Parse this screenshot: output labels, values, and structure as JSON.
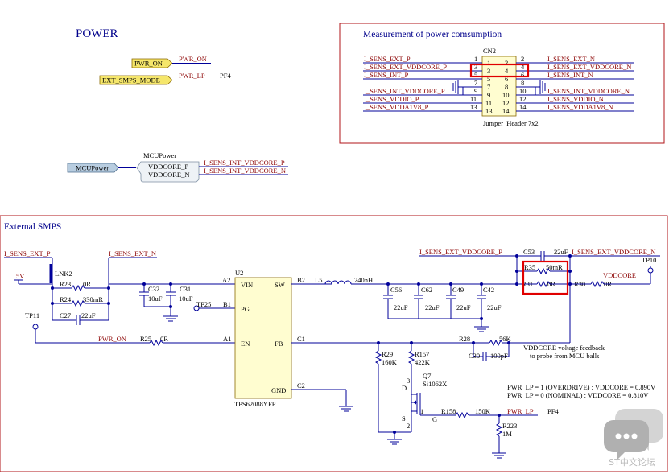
{
  "power": {
    "title": "POWER",
    "pwr_on_port": "PWR_ON",
    "pwr_on_net": "PWR_ON",
    "ext_smps_port": "EXT_SMPS_MODE",
    "pwr_lp_net": "PWR_LP",
    "pf4": "PF4"
  },
  "mcu": {
    "port": "MCUPower",
    "block_title": "MCUPower",
    "pin_p": "VDDCORE_P",
    "pin_n": "VDDCORE_N",
    "net_p": "I_SENS_INT_VDDCORE_P",
    "net_n": "I_SENS_INT_VDDCORE_N"
  },
  "measure": {
    "title": "Measurement of power comsumption",
    "connector_ref": "CN2",
    "connector_value": "Jumper_Header 7x2",
    "left_nets": [
      "I_SENS_EXT_P",
      "I_SENS_EXT_VDDCORE_P",
      "I_SENS_INT_P",
      "I_SENS_INT_VDDCORE_P",
      "I_SENS_VDDIO_P",
      "I_SENS_VDDA1V8_P"
    ],
    "right_nets": [
      "I_SENS_EXT_N",
      "I_SENS_EXT_VDDCORE_N",
      "I_SENS_INT_N",
      "I_SENS_INT_VDDCORE_N",
      "I_SENS_VDDIO_N",
      "I_SENS_VDDA1V8_N"
    ],
    "pins_left": [
      "1",
      "3",
      "5",
      "7",
      "9",
      "11",
      "13"
    ],
    "pins_right": [
      "2",
      "4",
      "6",
      "8",
      "10",
      "12",
      "14"
    ]
  },
  "smps": {
    "title": "External SMPS",
    "nets": {
      "sens_ext_p": "I_SENS_EXT_P",
      "sens_ext_n": "I_SENS_EXT_N",
      "ext_vddcore_p": "I_SENS_EXT_VDDCORE_P",
      "ext_vddcore_n": "I_SENS_EXT_VDDCORE_N",
      "v5": "5V",
      "pwr_on": "PWR_ON",
      "pwr_lp": "PWR_LP",
      "vddcore": "VDDCORE",
      "pf4": "PF4"
    },
    "lnk": "LNK2",
    "r23": "R23",
    "r23_val": "0R",
    "r24": "R24",
    "r24_val": "330mR",
    "c27": "C27",
    "c27_val": "22uF",
    "c32": "C32",
    "c32_val": "10uF",
    "c31": "C31",
    "c31_val": "10uF",
    "tp25": "TP25",
    "tp11": "TP11",
    "tp10": "TP10",
    "r25": "R25",
    "r25_val": "0R",
    "u2": "U2",
    "u2_part": "TPS62088YFP",
    "pins": {
      "vin": "VIN",
      "sw": "SW",
      "pg": "PG",
      "en": "EN",
      "fb": "FB",
      "gnd": "GND"
    },
    "pinnums": {
      "a2": "A2",
      "b2": "B2",
      "b1": "B1",
      "a1": "A1",
      "c1": "C1",
      "c2": "C2"
    },
    "l5": "L5",
    "l5_val": "240nH",
    "c56": "C56",
    "c62": "C62",
    "c49": "C49",
    "c42": "C42",
    "cap_22uf": "22uF",
    "c53": "C53",
    "c53_val": "22uF",
    "r35": "R35",
    "r35_val": "50mR",
    "r31": "R31",
    "r31_val": "0R",
    "r30": "R30",
    "r30_val": "0R",
    "r28": "R28",
    "r28_val": "56K",
    "c30": "C30",
    "c30_val": "100pF",
    "r29": "R29",
    "r29_val": "160K",
    "r157": "R157",
    "r157_val": "422K",
    "q7": "Q7",
    "q7_part": "Si1062X",
    "q_pins": {
      "d": "D",
      "g": "G",
      "s": "S",
      "n3": "3",
      "n1": "1",
      "n2": "2"
    },
    "r158": "R158",
    "r158_val": "150K",
    "r223": "R223",
    "r223_val": "1M",
    "feedback_note_1": "VDDCORE voltage feedback",
    "feedback_note_2": "to probe from MCU balls",
    "mode_1": "PWR_LP = 1 (OVERDRIVE) : VDDCORE = 0.890V",
    "mode_2": "PWR_LP = 0 (NOMINAL) : VDDCORE = 0.810V"
  },
  "watermark": {
    "text": "ST中文论坛"
  }
}
